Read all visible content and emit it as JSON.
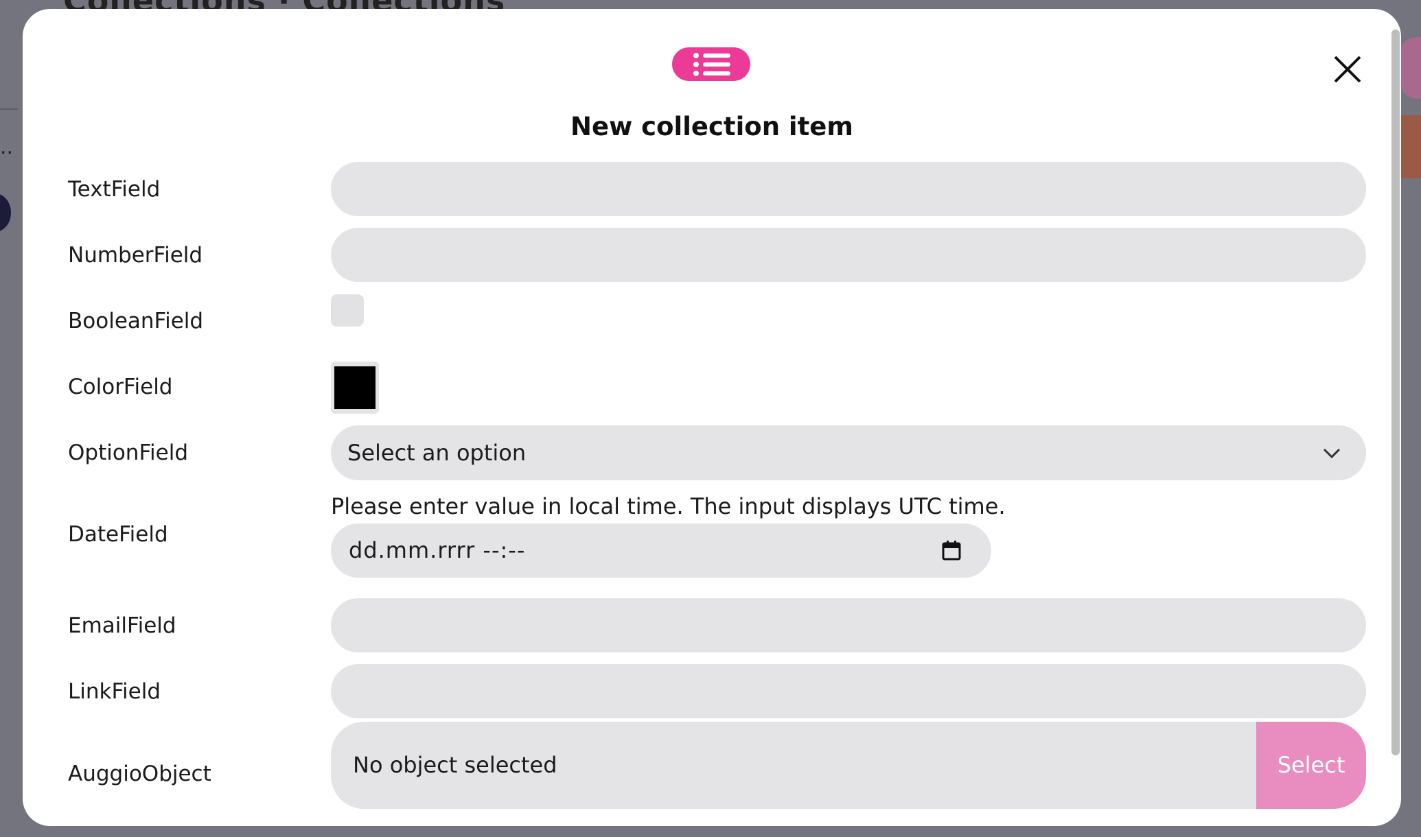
{
  "background": {
    "page_title": "Collections · Collections",
    "overflow_marker": ".."
  },
  "modal": {
    "title": "New collection item",
    "header_icon": "list-icon",
    "close_icon": "close-icon"
  },
  "fields": {
    "text": {
      "label": "TextField",
      "value": ""
    },
    "number": {
      "label": "NumberField",
      "value": ""
    },
    "boolean": {
      "label": "BooleanField",
      "checked": false
    },
    "color": {
      "label": "ColorField",
      "value": "#000000"
    },
    "option": {
      "label": "OptionField",
      "selected": "Select an option",
      "icon": "chevron-down-icon"
    },
    "date": {
      "label": "DateField",
      "hint": "Please enter value in local time. The input displays UTC time.",
      "placeholder": "dd.mm.rrrr --:--",
      "icon": "calendar-icon"
    },
    "email": {
      "label": "EmailField",
      "value": ""
    },
    "link": {
      "label": "LinkField",
      "value": ""
    },
    "auggio_object": {
      "label": "AuggioObject",
      "value": "No object selected",
      "button_label": "Select"
    }
  },
  "colors": {
    "accent": "#ec3b97",
    "select_button": "#e98cc0",
    "input_background": "#e4e4e6",
    "overlay": "#74747f"
  }
}
